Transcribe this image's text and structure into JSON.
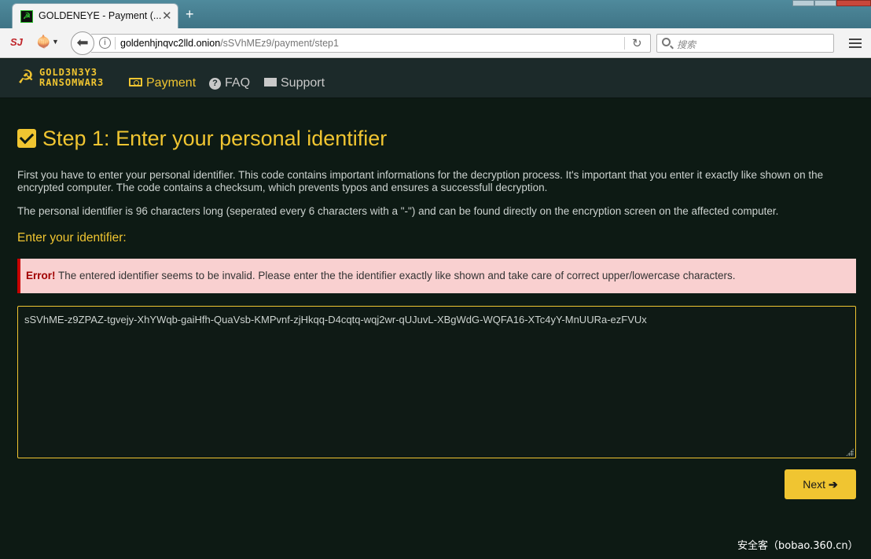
{
  "browser": {
    "tab_title": "GOLDENEYE - Payment (...",
    "tab_close": "✕",
    "new_tab": "+",
    "url_host": "goldenhjnqvc2lld.onion",
    "url_path": "/sSVhMEz9/payment/step1",
    "search_placeholder": "搜索",
    "ext_label": "SJ"
  },
  "header": {
    "logo_line1": "GOLD3N3Y3",
    "logo_line2": "RANSOMWAR3",
    "nav": {
      "payment": "Payment",
      "faq": "FAQ",
      "support": "Support"
    }
  },
  "main": {
    "title": "Step 1: Enter your personal identifier",
    "para1": "First you have to enter your personal identifier. This code contains important informations for the decryption process. It's important that you enter it exactly like shown on the encrypted computer. The code contains a checksum, which prevents typos and ensures a successfull decryption.",
    "para2": "The personal identifier is 96 characters long (seperated every 6 characters with a \"-\") and can be found directly on the encryption screen on the affected computer.",
    "field_label": "Enter your identifier:",
    "alert_strong": "Error!",
    "alert_text": " The entered identifier seems to be invalid. Please enter the the identifier exactly like shown and take care of correct upper/lowercase characters.",
    "identifier_value": "sSVhME-z9ZPAZ-tgvejy-XhYWqb-gaiHfh-QuaVsb-KMPvnf-zjHkqq-D4cqtq-wqj2wr-qUJuvL-XBgWdG-WQFA16-XTc4yY-MnUURa-ezFVUx",
    "next_label": "Next",
    "next_arrow": "➔"
  },
  "watermark": "安全客（bobao.360.cn）",
  "colors": {
    "accent": "#f0c531",
    "background": "#0d1a14",
    "header_bg": "#1c2a2a",
    "error_bg": "#f9d0d0",
    "error_border": "#c80000"
  },
  "icons": {
    "tab_favicon": "hammer-sickle-icon",
    "logo": "hammer-sickle-icon",
    "payment": "money-bill-icon",
    "faq": "question-circle-icon",
    "support": "envelope-icon",
    "title": "check-square-icon"
  }
}
